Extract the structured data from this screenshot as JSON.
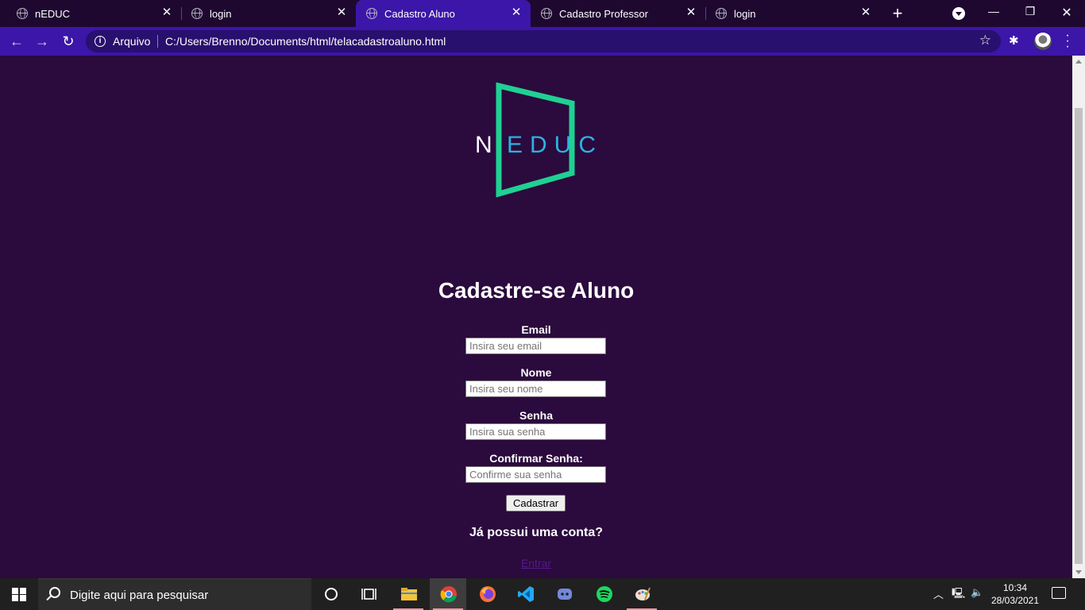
{
  "browser": {
    "tabs": [
      {
        "title": "nEDUC",
        "active": false
      },
      {
        "title": "login",
        "active": false
      },
      {
        "title": "Cadastro Aluno",
        "active": true
      },
      {
        "title": "Cadastro Professor",
        "active": false
      },
      {
        "title": "login",
        "active": false
      }
    ],
    "security_label": "Arquivo",
    "url": "C:/Users/Brenno/Documents/html/telacadastroaluno.html"
  },
  "page": {
    "logo": {
      "text_n": "N",
      "text_rest": "EDUC"
    },
    "heading": "Cadastre-se Aluno",
    "form": {
      "fields": [
        {
          "label": "Email",
          "placeholder": "Insira seu email"
        },
        {
          "label": "Nome",
          "placeholder": "Insira seu nome"
        },
        {
          "label": "Senha",
          "placeholder": "Insira sua senha"
        },
        {
          "label": "Confirmar Senha:",
          "placeholder": "Confirme sua senha"
        }
      ],
      "submit_label": "Cadastrar"
    },
    "account_question": "Já possui uma conta?",
    "login_link": "Entrar"
  },
  "taskbar": {
    "search_placeholder": "Digite aqui para pesquisar",
    "time": "10:34",
    "date": "28/03/2021"
  },
  "colors": {
    "page_background": "#2b0a3d",
    "browser_accent": "#3b16a8",
    "logo_green": "#1fd192",
    "logo_blue": "#2bb3e0"
  }
}
